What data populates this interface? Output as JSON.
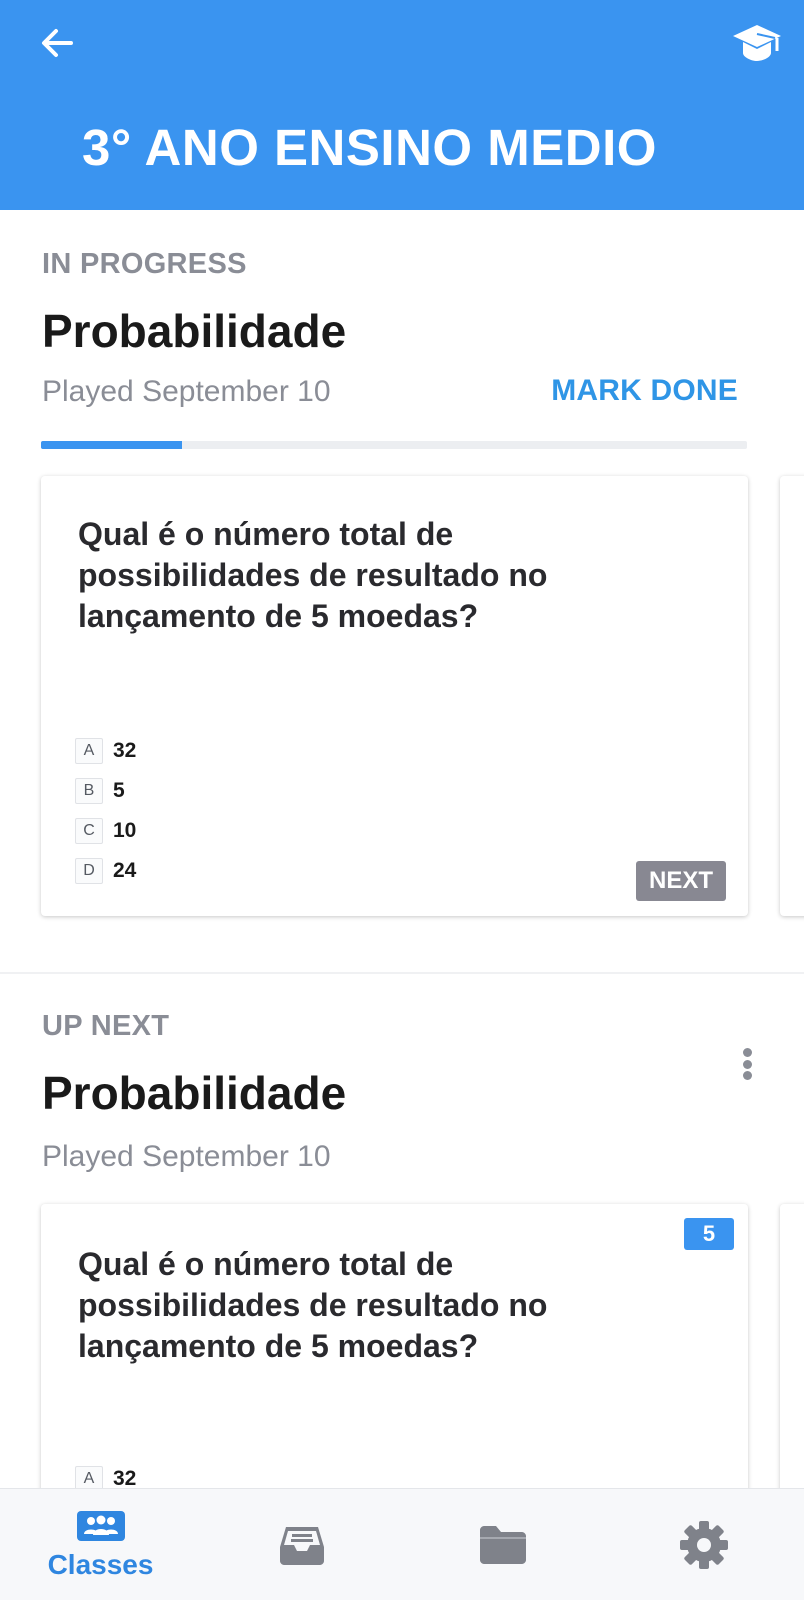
{
  "header": {
    "title": "3° ANO ENSINO MEDIO"
  },
  "in_progress": {
    "label": "IN PROGRESS",
    "quiz_title": "Probabilidade",
    "played": "Played September 10",
    "mark_done": "MARK DONE",
    "progress_fraction": 0.2,
    "card": {
      "question": "Qual é o número total de possibilidades de resultado no lançamento de 5 moedas?",
      "options": [
        {
          "letter": "A",
          "text": "32"
        },
        {
          "letter": "B",
          "text": "5"
        },
        {
          "letter": "C",
          "text": "10"
        },
        {
          "letter": "D",
          "text": "24"
        }
      ],
      "next_label": "NEXT"
    }
  },
  "up_next": {
    "label": "UP NEXT",
    "quiz_title": "Probabilidade",
    "played": "Played September 10",
    "card": {
      "badge": "5",
      "question": "Qual é o número total de possibilidades de resultado no lançamento de 5 moedas?",
      "options": [
        {
          "letter": "A",
          "text": "32"
        }
      ]
    }
  },
  "bottom_nav": {
    "items": [
      {
        "label": "Classes",
        "icon": "classes-icon",
        "active": true
      },
      {
        "label": "",
        "icon": "inbox-icon",
        "active": false
      },
      {
        "label": "",
        "icon": "folder-icon",
        "active": false
      },
      {
        "label": "",
        "icon": "gear-icon",
        "active": false
      }
    ]
  },
  "colors": {
    "header_blue": "#3a94f0",
    "accent_blue": "#2f95e6",
    "muted_gray": "#8a8d96",
    "next_button_gray": "#888892"
  }
}
